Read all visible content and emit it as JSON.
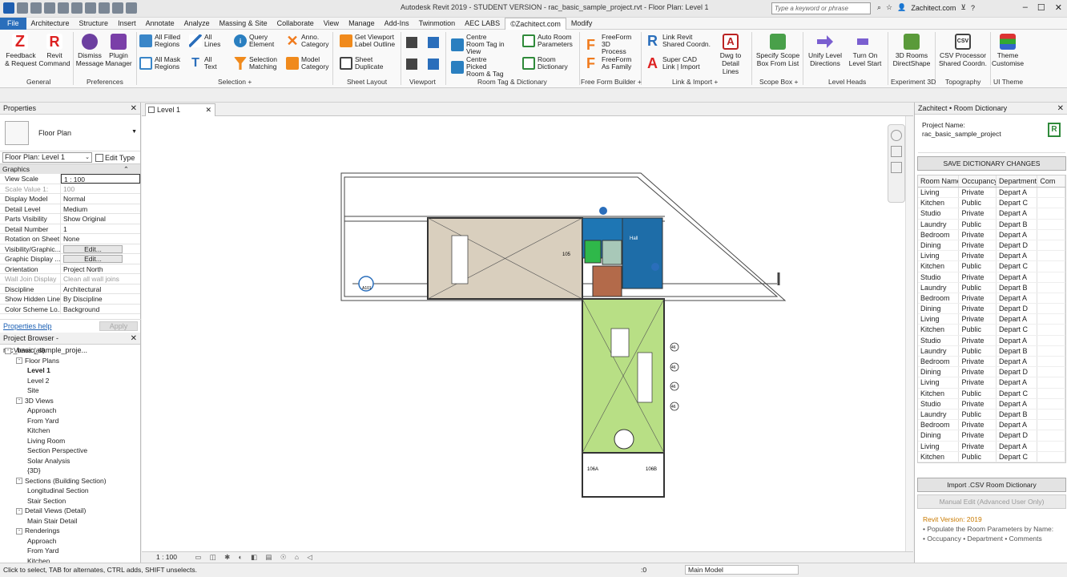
{
  "title": "Autodesk Revit 2019 - STUDENT VERSION - rac_basic_sample_project.rvt - Floor Plan: Level 1",
  "search_placeholder": "Type a keyword or phrase",
  "user": "Zachitect.com",
  "tabs": [
    "File",
    "Architecture",
    "Structure",
    "Insert",
    "Annotate",
    "Analyze",
    "Massing & Site",
    "Collaborate",
    "View",
    "Manage",
    "Add-Ins",
    "Twinmotion",
    "AEC LABS",
    "©Zachitect.com",
    "Modify"
  ],
  "ribbon": {
    "feedback": "Feedback & Request",
    "revit_command": "Revit Command",
    "dismiss": "Dismiss Message",
    "plugin_manager": "Plugin Manager",
    "all_filled": "All Filled Regions",
    "all_lines": "All Lines",
    "query_element": "Query Element",
    "anno_category": "Anno. Category",
    "all_mask": "All Mask Regions",
    "all_text": "All Text",
    "selection_matching": "Selection Matching",
    "model_category": "Model Category",
    "get_viewport": "Get Viewport Label Outline",
    "sheet_duplicate": "Sheet Duplicate",
    "centre_room": "Centre Room Tag in View",
    "centre_picked": "Centre Picked Room & Tag",
    "auto_room": "Auto Room Parameters",
    "room_dictionary": "Room Dictionary",
    "freeform_3d": "FreeForm 3D Process",
    "freeform_family": "FreeForm As Family",
    "link_revit": "Link Revit Shared Coordn.",
    "super_cad": "Super CAD Link | Import",
    "dwg_detail": "Dwg to Detail Lines",
    "specify_scope": "Specify Scope Box From List",
    "unify_level": "Unify Level Directions",
    "turn_on_level": "Turn On Level Start",
    "rooms_3d": "3D Rooms DirectShape",
    "csv_processor": "CSV Processor Shared Coordn.",
    "theme": "Theme Customise",
    "groups": [
      "General",
      "Preferences",
      "Selection +",
      "Sheet Layout",
      "Viewport",
      "Room Tag & Dictionary",
      "Free Form Builder +",
      "Link & Import +",
      "Scope Box +",
      "Level Heads",
      "Experiment 3D",
      "Topography",
      "UI Theme"
    ]
  },
  "properties": {
    "title": "Properties",
    "type": "Floor Plan",
    "instance": "Floor Plan: Level 1",
    "edit_type": "Edit Type",
    "group_graphics": "Graphics",
    "rows": [
      {
        "k": "View Scale",
        "v": "1 : 100"
      },
      {
        "k": "Scale Value    1:",
        "v": "100"
      },
      {
        "k": "Display Model",
        "v": "Normal"
      },
      {
        "k": "Detail Level",
        "v": "Medium"
      },
      {
        "k": "Parts Visibility",
        "v": "Show Original"
      },
      {
        "k": "Detail Number",
        "v": "1"
      },
      {
        "k": "Rotation on Sheet",
        "v": "None"
      },
      {
        "k": "Visibility/Graphic...",
        "v": "Edit..."
      },
      {
        "k": "Graphic Display ...",
        "v": "Edit..."
      },
      {
        "k": "Orientation",
        "v": "Project North"
      },
      {
        "k": "Wall Join Display",
        "v": "Clean all wall joins"
      },
      {
        "k": "Discipline",
        "v": "Architectural"
      },
      {
        "k": "Show Hidden Lines",
        "v": "By Discipline"
      },
      {
        "k": "Color Scheme Lo...",
        "v": "Background"
      }
    ],
    "help": "Properties help",
    "apply": "Apply"
  },
  "browser": {
    "title": "Project Browser - rac_basic_sample_proje...",
    "nodes": [
      {
        "t": "Views (all)",
        "l": 0,
        "tg": "-"
      },
      {
        "t": "Floor Plans",
        "l": 1,
        "tg": "-"
      },
      {
        "t": "Level 1",
        "l": 2,
        "sel": true
      },
      {
        "t": "Level 2",
        "l": 2
      },
      {
        "t": "Site",
        "l": 2
      },
      {
        "t": "3D Views",
        "l": 1,
        "tg": "-"
      },
      {
        "t": "Approach",
        "l": 2
      },
      {
        "t": "From Yard",
        "l": 2
      },
      {
        "t": "Kitchen",
        "l": 2
      },
      {
        "t": "Living Room",
        "l": 2
      },
      {
        "t": "Section Perspective",
        "l": 2
      },
      {
        "t": "Solar Analysis",
        "l": 2
      },
      {
        "t": "{3D}",
        "l": 2
      },
      {
        "t": "Sections (Building Section)",
        "l": 1,
        "tg": "-"
      },
      {
        "t": "Longitudinal Section",
        "l": 2
      },
      {
        "t": "Stair Section",
        "l": 2
      },
      {
        "t": "Detail Views (Detail)",
        "l": 1,
        "tg": "-"
      },
      {
        "t": "Main Stair Detail",
        "l": 2
      },
      {
        "t": "Renderings",
        "l": 1,
        "tg": "-"
      },
      {
        "t": "Approach",
        "l": 2
      },
      {
        "t": "From Yard",
        "l": 2
      },
      {
        "t": "Kitchen",
        "l": 2
      }
    ]
  },
  "view_tab": "Level 1",
  "view_scale": "1 : 100",
  "plan_tags": {
    "t105": "105",
    "t106a": "106A",
    "t106b": "106B",
    "hall": "Hall",
    "t46a": "46",
    "t46b": "46",
    "t46c": "46",
    "t46d": "46",
    "a101": "A101"
  },
  "dock": {
    "title": "Zachitect • Room Dictionary",
    "project_label": "Project Name:",
    "project_name": "rac_basic_sample_project",
    "save_btn": "SAVE DICTIONARY CHANGES",
    "headers": [
      "Room Name",
      "Occupancy",
      "Department",
      "Com"
    ],
    "rows": [
      [
        "Living",
        "Private",
        "Depart A"
      ],
      [
        "Kitchen",
        "Public",
        "Depart C"
      ],
      [
        "Studio",
        "Private",
        "Depart A"
      ],
      [
        "Laundry",
        "Public",
        "Depart B"
      ],
      [
        "Bedroom",
        "Private",
        "Depart A"
      ],
      [
        "Dining",
        "Private",
        "Depart D"
      ],
      [
        "Living",
        "Private",
        "Depart A"
      ],
      [
        "Kitchen",
        "Public",
        "Depart C"
      ],
      [
        "Studio",
        "Private",
        "Depart A"
      ],
      [
        "Laundry",
        "Public",
        "Depart B"
      ],
      [
        "Bedroom",
        "Private",
        "Depart A"
      ],
      [
        "Dining",
        "Private",
        "Depart D"
      ],
      [
        "Living",
        "Private",
        "Depart A"
      ],
      [
        "Kitchen",
        "Public",
        "Depart C"
      ],
      [
        "Studio",
        "Private",
        "Depart A"
      ],
      [
        "Laundry",
        "Public",
        "Depart B"
      ],
      [
        "Bedroom",
        "Private",
        "Depart A"
      ],
      [
        "Dining",
        "Private",
        "Depart D"
      ],
      [
        "Living",
        "Private",
        "Depart A"
      ],
      [
        "Kitchen",
        "Public",
        "Depart C"
      ],
      [
        "Studio",
        "Private",
        "Depart A"
      ],
      [
        "Laundry",
        "Public",
        "Depart B"
      ],
      [
        "Bedroom",
        "Private",
        "Depart A"
      ],
      [
        "Dining",
        "Private",
        "Depart D"
      ],
      [
        "Living",
        "Private",
        "Depart A"
      ],
      [
        "Kitchen",
        "Public",
        "Depart C"
      ]
    ],
    "import_btn": "Import .CSV Room Dictionary",
    "manual_btn": "Manual Edit (Advanced User Only)",
    "version": "Revit Version: 2019",
    "info1": "• Populate the Room Parameters by Name:",
    "info2": "• Occupancy  • Department  • Comments"
  },
  "status": "Click to select, TAB for alternates, CTRL adds, SHIFT unselects.",
  "status_zero": ":0",
  "model": "Main Model"
}
